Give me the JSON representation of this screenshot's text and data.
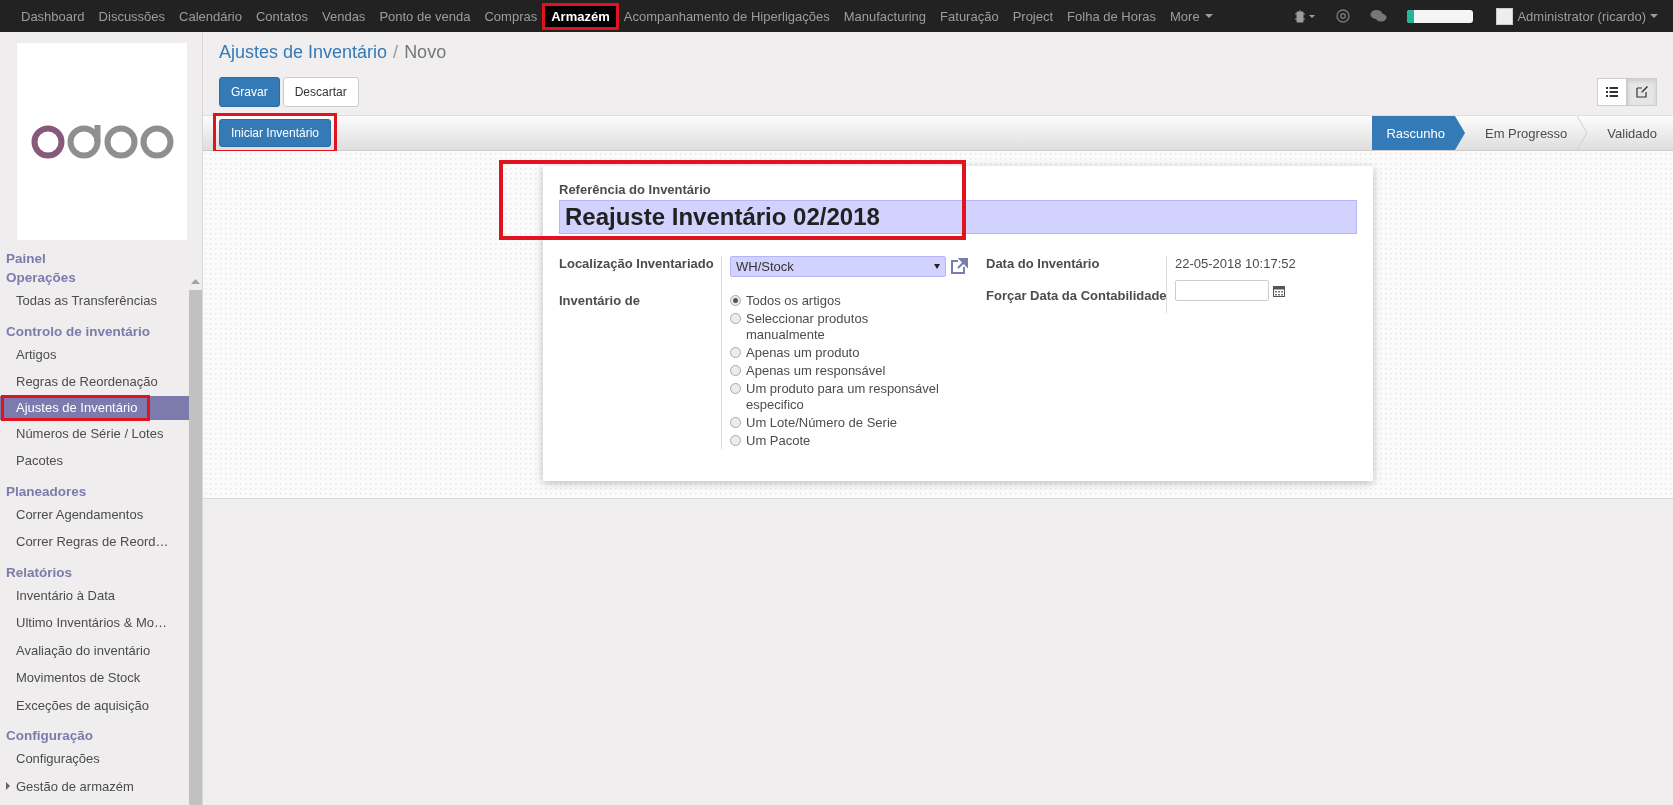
{
  "top_menu": [
    {
      "label": "Dashboard",
      "highlighted": false
    },
    {
      "label": "Discussões",
      "highlighted": false
    },
    {
      "label": "Calendário",
      "highlighted": false
    },
    {
      "label": "Contatos",
      "highlighted": false
    },
    {
      "label": "Vendas",
      "highlighted": false
    },
    {
      "label": "Ponto de venda",
      "highlighted": false
    },
    {
      "label": "Compras",
      "highlighted": false
    },
    {
      "label": "Armazém",
      "highlighted": true
    },
    {
      "label": "Acompanhamento de Hiperligações",
      "highlighted": false
    },
    {
      "label": "Manufacturing",
      "highlighted": false
    },
    {
      "label": "Faturação",
      "highlighted": false
    },
    {
      "label": "Project",
      "highlighted": false
    },
    {
      "label": "Folha de Horas",
      "highlighted": false
    }
  ],
  "more_menu": "More",
  "systray": {
    "progress": {
      "level": 0.1
    },
    "user": "Administrator (ricardo)"
  },
  "sidebar": {
    "sections": [
      {
        "title": "Painel"
      },
      {
        "title": "Operações",
        "items": [
          {
            "label": "Todas as Transferências",
            "kind": "link",
            "selected": false,
            "highlighted": false
          }
        ]
      },
      {
        "title": "Controlo de inventário",
        "items": [
          {
            "label": "Artigos",
            "kind": "link",
            "selected": false,
            "highlighted": false
          },
          {
            "label": "Regras de Reordenação",
            "kind": "link",
            "selected": false,
            "highlighted": false
          },
          {
            "label": "Ajustes de Inventário",
            "kind": "link",
            "selected": true,
            "highlighted": true
          },
          {
            "label": "Números de Série / Lotes",
            "kind": "link",
            "selected": false,
            "highlighted": false
          },
          {
            "label": "Pacotes",
            "kind": "link",
            "selected": false,
            "highlighted": false
          }
        ]
      },
      {
        "title": "Planeadores",
        "items": [
          {
            "label": "Correr Agendamentos",
            "kind": "link",
            "selected": false,
            "highlighted": false
          },
          {
            "label": "Correr Regras de Reord…",
            "kind": "link",
            "selected": false,
            "highlighted": false
          }
        ]
      },
      {
        "title": "Relatórios",
        "items": [
          {
            "label": "Inventário à Data",
            "kind": "link",
            "selected": false,
            "highlighted": false
          },
          {
            "label": "Ultimo Inventários & Mo…",
            "kind": "link",
            "selected": false,
            "highlighted": false
          },
          {
            "label": "Avaliação do inventário",
            "kind": "link",
            "selected": false,
            "highlighted": false
          },
          {
            "label": "Movimentos de Stock",
            "kind": "link",
            "selected": false,
            "highlighted": false
          },
          {
            "label": "Exceções de aquisição",
            "kind": "link",
            "selected": false,
            "highlighted": false
          }
        ]
      },
      {
        "title": "Configuração",
        "items": [
          {
            "label": "Configurações",
            "kind": "link",
            "selected": false,
            "highlighted": false
          },
          {
            "label": "Gestão de armazém",
            "kind": "collapsed-group",
            "selected": false,
            "highlighted": false
          }
        ]
      }
    ]
  },
  "breadcrumb": {
    "items": [
      "Ajustes de Inventário",
      "Novo"
    ],
    "separator": "/"
  },
  "buttons": {
    "save": "Gravar",
    "discard": "Descartar"
  },
  "view_switcher": [
    {
      "kind": "list",
      "selected": false
    },
    {
      "kind": "form",
      "selected": true
    }
  ],
  "header": {
    "action": {
      "label": "Iniciar Inventário",
      "highlighted": true
    },
    "stages": [
      {
        "label": "Rascunho",
        "selected": true
      },
      {
        "label": "Em Progresso",
        "selected": false
      },
      {
        "label": "Validado",
        "selected": false
      }
    ]
  },
  "form": {
    "reference": {
      "label": "Referência do Inventário",
      "value": "Reajuste Inventário 02/2018",
      "highlighted": true
    },
    "location": {
      "label": "Localização Inventariado",
      "value": "WH/Stock"
    },
    "inventory_of": {
      "label": "Inventário de",
      "options": [
        {
          "label": "Todos os artigos",
          "selected": true
        },
        {
          "label": "Seleccionar produtos manualmente",
          "selected": false
        },
        {
          "label": "Apenas um produto",
          "selected": false
        },
        {
          "label": "Apenas um responsável",
          "selected": false
        },
        {
          "label": "Um produto para um responsável especifico",
          "selected": false
        },
        {
          "label": "Um Lote/Número de Serie",
          "selected": false
        },
        {
          "label": "Um Pacote",
          "selected": false
        }
      ]
    },
    "date": {
      "label": "Data do Inventário",
      "value": "22-05-2018 10:17:52"
    },
    "accounting_date": {
      "label": "Forçar Data da Contabilidade"
    }
  }
}
